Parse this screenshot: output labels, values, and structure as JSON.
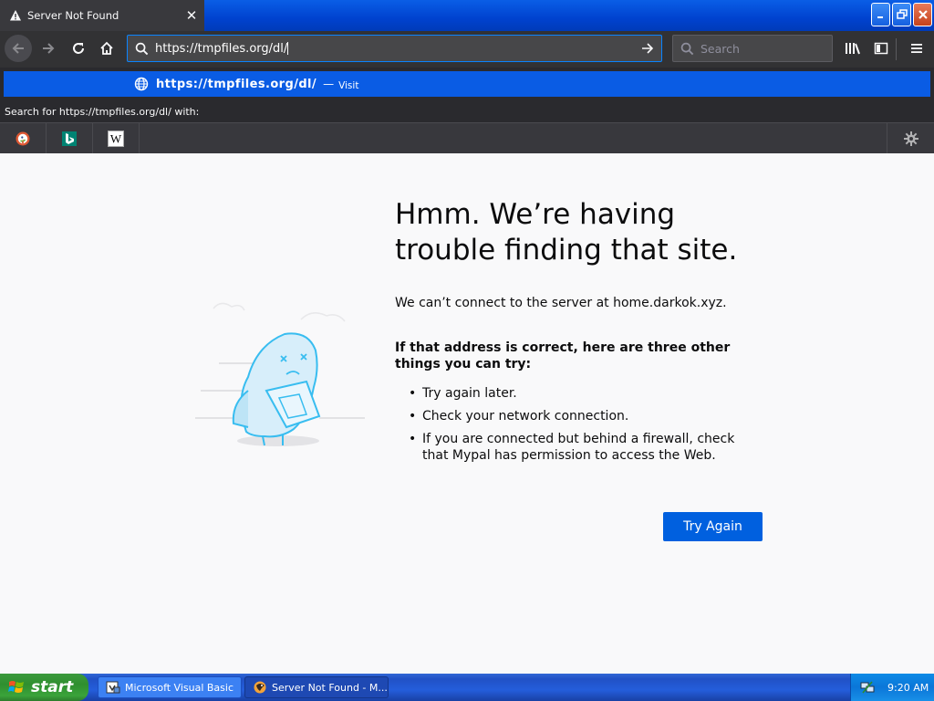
{
  "tab": {
    "title": "Server Not Found",
    "close": "✕"
  },
  "window_controls": {
    "minimize": "_",
    "restore": "❐",
    "close": "✕"
  },
  "navbar": {
    "url": "https://tmpfiles.org/dl/",
    "search_placeholder": "Search"
  },
  "autocomplete": {
    "url": "https://tmpfiles.org/dl/",
    "dash": "—",
    "action": "Visit",
    "search_with": "Search for https://tmpfiles.org/dl/ with:",
    "engines": [
      "DuckDuckGo",
      "Bing",
      "Wikipedia"
    ],
    "wiki_glyph": "W"
  },
  "error": {
    "title": "Hmm. We’re having trouble finding that site.",
    "description": "We can’t connect to the server at home.darkok.xyz.",
    "tips_heading": "If that address is correct, here are three other things you can try:",
    "tips": [
      "Try again later.",
      "Check your network connection.",
      "If you are connected but behind a firewall, check that Mypal has permission to access the Web."
    ],
    "button": "Try Again"
  },
  "taskbar": {
    "start": "start",
    "tasks": [
      "Microsoft Visual Basic",
      "Server Not Found - M..."
    ],
    "clock": "9:20 AM"
  },
  "colors": {
    "accent": "#0060df",
    "autocomplete_highlight": "#0a5ce4",
    "toolbar_dark": "#323234",
    "page_bg": "#f9f9fa"
  }
}
